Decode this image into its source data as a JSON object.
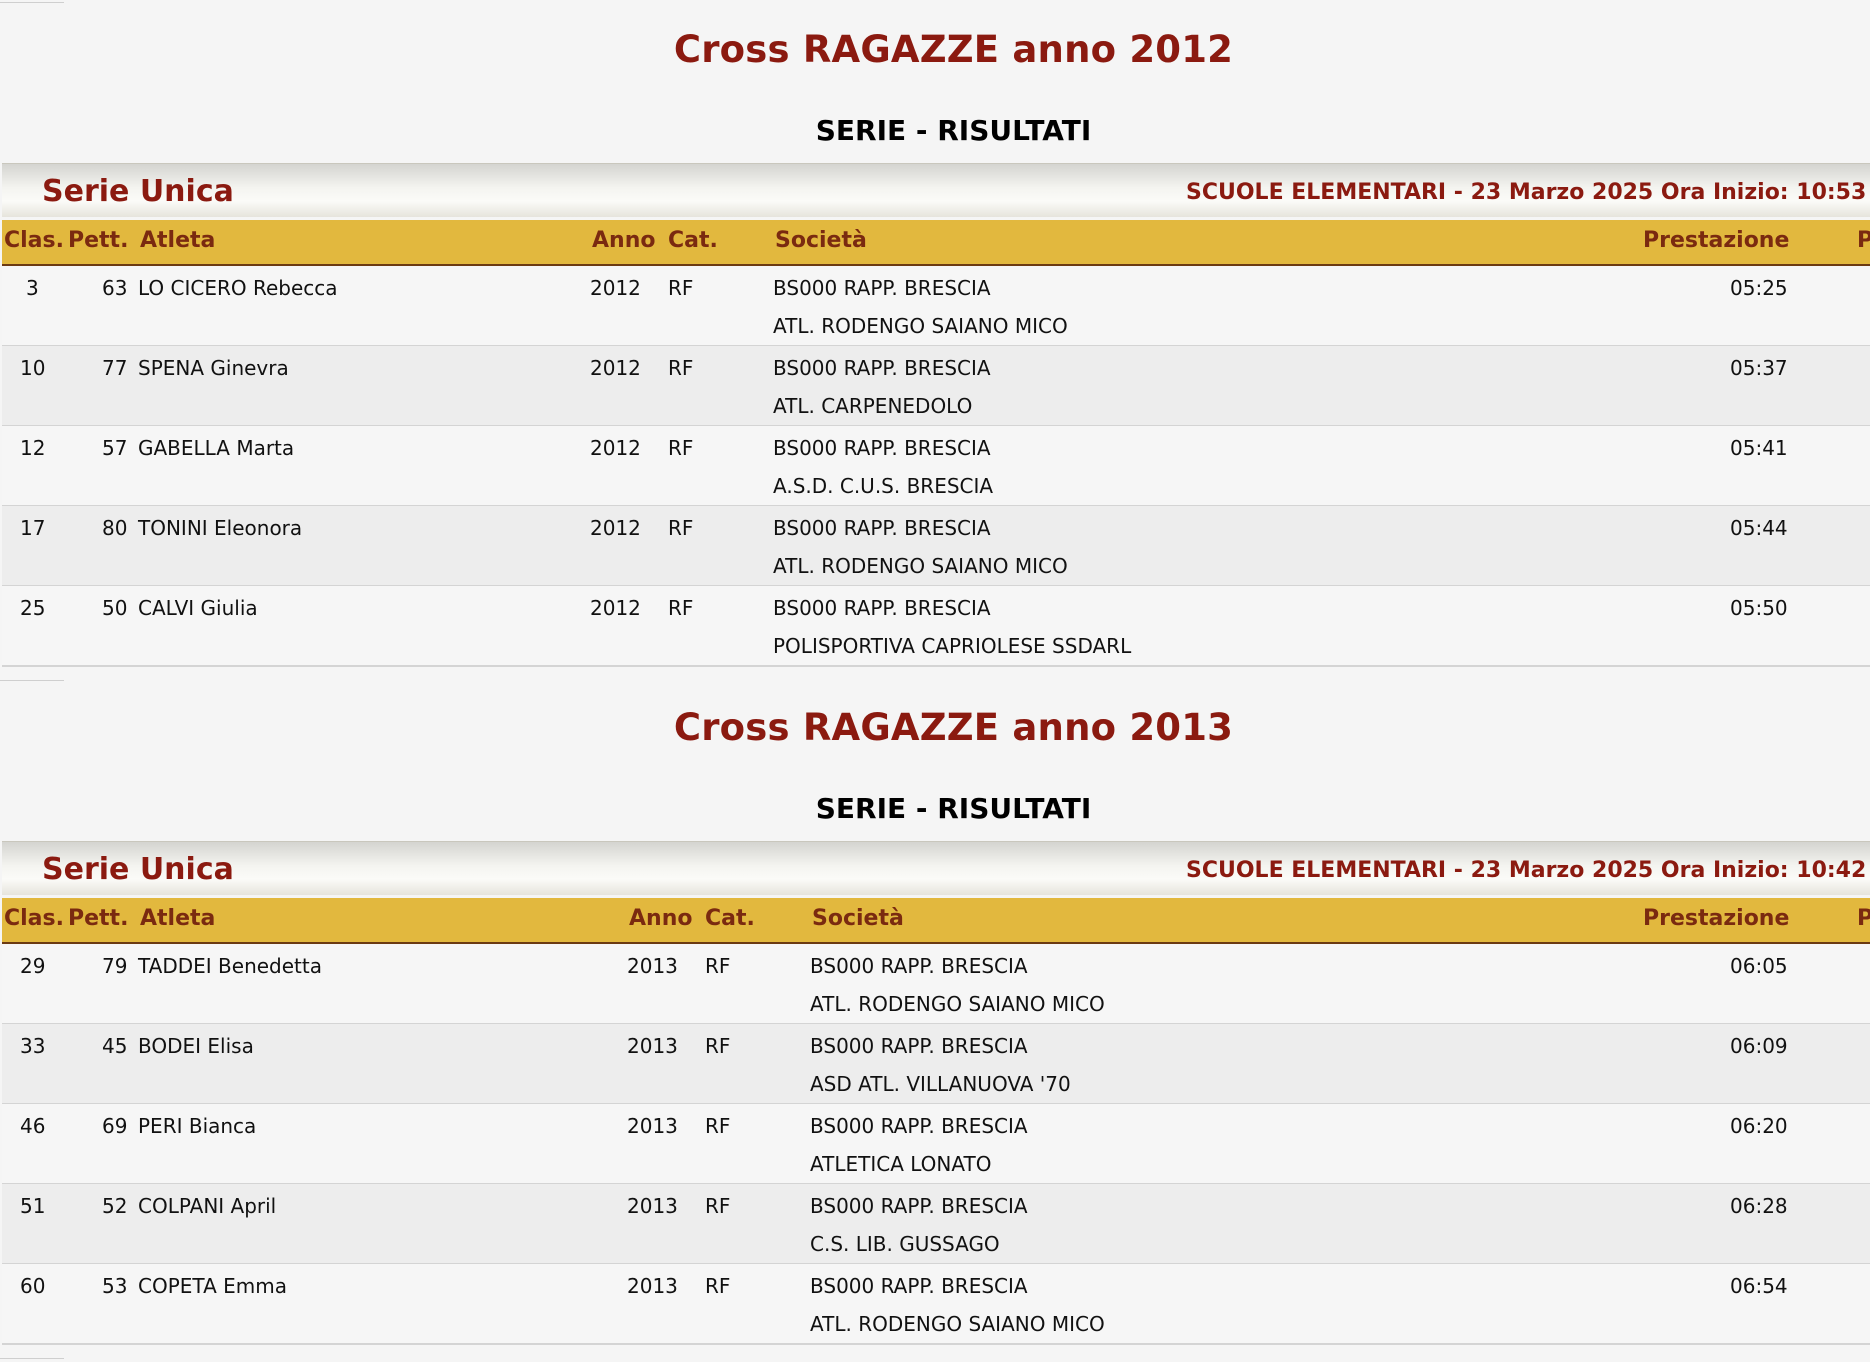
{
  "sections": [
    {
      "title": "Cross RAGAZZE anno 2012",
      "subtitle": "SERIE - RISULTATI",
      "serie_name": "Serie Unica",
      "serie_info": "SCUOLE ELEMENTARI - 23 Marzo 2025 Ora Inizio: 10:53",
      "headers": {
        "clas": "Clas.",
        "pett": "Pett.",
        "atleta": "Atleta",
        "anno": "Anno",
        "cat": "Cat.",
        "societa": "Società",
        "prestazione": "Prestazione",
        "extra": "P"
      },
      "rows": [
        {
          "clas": "3",
          "pett": "63",
          "atleta": "LO CICERO Rebecca",
          "anno": "2012",
          "cat": "RF",
          "societa1": "BS000 RAPP. BRESCIA",
          "societa2": "ATL. RODENGO SAIANO MICO",
          "prestazione": "05:25"
        },
        {
          "clas": "10",
          "pett": "77",
          "atleta": "SPENA Ginevra",
          "anno": "2012",
          "cat": "RF",
          "societa1": "BS000 RAPP. BRESCIA",
          "societa2": "ATL. CARPENEDOLO",
          "prestazione": "05:37"
        },
        {
          "clas": "12",
          "pett": "57",
          "atleta": "GABELLA Marta",
          "anno": "2012",
          "cat": "RF",
          "societa1": "BS000 RAPP. BRESCIA",
          "societa2": "A.S.D. C.U.S. BRESCIA",
          "prestazione": "05:41"
        },
        {
          "clas": "17",
          "pett": "80",
          "atleta": "TONINI Eleonora",
          "anno": "2012",
          "cat": "RF",
          "societa1": "BS000 RAPP. BRESCIA",
          "societa2": "ATL. RODENGO SAIANO MICO",
          "prestazione": "05:44"
        },
        {
          "clas": "25",
          "pett": "50",
          "atleta": "CALVI Giulia",
          "anno": "2012",
          "cat": "RF",
          "societa1": "BS000 RAPP. BRESCIA",
          "societa2": "POLISPORTIVA CAPRIOLESE SSDARL",
          "prestazione": "05:50"
        }
      ]
    },
    {
      "title": "Cross RAGAZZE anno 2013",
      "subtitle": "SERIE - RISULTATI",
      "serie_name": "Serie Unica",
      "serie_info": "SCUOLE ELEMENTARI - 23 Marzo 2025 Ora Inizio: 10:42",
      "headers": {
        "clas": "Clas.",
        "pett": "Pett.",
        "atleta": "Atleta",
        "anno": "Anno",
        "cat": "Cat.",
        "societa": "Società",
        "prestazione": "Prestazione",
        "extra": "P"
      },
      "rows": [
        {
          "clas": "29",
          "pett": "79",
          "atleta": "TADDEI Benedetta",
          "anno": "2013",
          "cat": "RF",
          "societa1": "BS000 RAPP. BRESCIA",
          "societa2": "ATL. RODENGO SAIANO MICO",
          "prestazione": "06:05"
        },
        {
          "clas": "33",
          "pett": "45",
          "atleta": "BODEI Elisa",
          "anno": "2013",
          "cat": "RF",
          "societa1": "BS000 RAPP. BRESCIA",
          "societa2": "ASD ATL. VILLANUOVA '70",
          "prestazione": "06:09"
        },
        {
          "clas": "46",
          "pett": "69",
          "atleta": "PERI Bianca",
          "anno": "2013",
          "cat": "RF",
          "societa1": "BS000 RAPP. BRESCIA",
          "societa2": "ATLETICA LONATO",
          "prestazione": "06:20"
        },
        {
          "clas": "51",
          "pett": "52",
          "atleta": "COLPANI April",
          "anno": "2013",
          "cat": "RF",
          "societa1": "BS000 RAPP. BRESCIA",
          "societa2": "C.S. LIB. GUSSAGO",
          "prestazione": "06:28"
        },
        {
          "clas": "60",
          "pett": "53",
          "atleta": "COPETA Emma",
          "anno": "2013",
          "cat": "RF",
          "societa1": "BS000 RAPP. BRESCIA",
          "societa2": "ATL. RODENGO SAIANO MICO",
          "prestazione": "06:54"
        }
      ]
    }
  ]
}
